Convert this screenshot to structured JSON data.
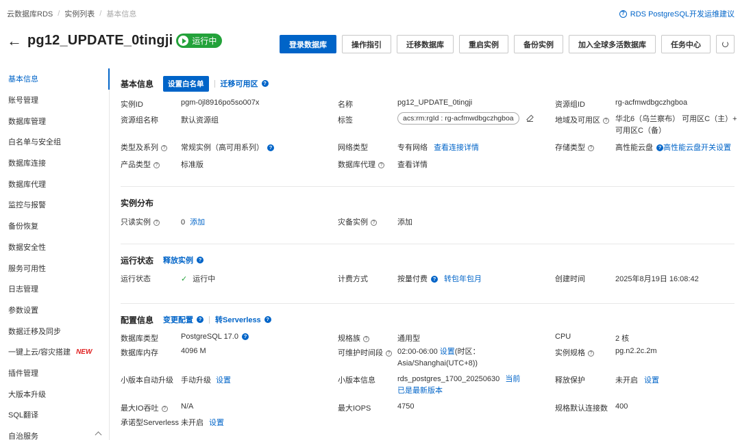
{
  "breadcrumb": [
    "云数据库RDS",
    "实例列表",
    "基本信息"
  ],
  "help_link": "RDS PostgreSQL开发运维建议",
  "title": "pg12_UPDATE_0tingji",
  "status": "运行中",
  "actions": [
    "登录数据库",
    "操作指引",
    "迁移数据库",
    "重启实例",
    "备份实例",
    "加入全球多活数据库",
    "任务中心"
  ],
  "sidebar": [
    {
      "label": "基本信息"
    },
    {
      "label": "账号管理"
    },
    {
      "label": "数据库管理"
    },
    {
      "label": "白名单与安全组"
    },
    {
      "label": "数据库连接"
    },
    {
      "label": "数据库代理"
    },
    {
      "label": "监控与报警"
    },
    {
      "label": "备份恢复"
    },
    {
      "label": "数据安全性"
    },
    {
      "label": "服务可用性"
    },
    {
      "label": "日志管理"
    },
    {
      "label": "参数设置"
    },
    {
      "label": "数据迁移及同步"
    },
    {
      "label": "一键上云/容灾搭建",
      "badge": "NEW"
    },
    {
      "label": "插件管理"
    },
    {
      "label": "大版本升级"
    },
    {
      "label": "SQL翻译"
    },
    {
      "label": "自治服务"
    }
  ],
  "basic": {
    "title": "基本信息",
    "whitelist_btn": "设置白名单",
    "migrate_link": "迁移可用区",
    "instance_id_label": "实例ID",
    "instance_id": "pgm-0jl8916po5so007x",
    "name_label": "名称",
    "name": "pg12_UPDATE_0tingji",
    "rg_id_label": "资源组ID",
    "rg_id": "rg-acfmwdbgczhgboa",
    "rg_name_label": "资源组名称",
    "rg_name": "默认资源组",
    "tags_label": "标签",
    "tags": "acs:rm:rgId : rg-acfmwdbgczhgboa",
    "region_label": "地域及可用区",
    "region": "华北6（乌兰察布） 可用区C（主）+ 可用区C（备）",
    "series_label": "类型及系列",
    "series": "常规实例（高可用系列）",
    "network_label": "网络类型",
    "network": "专有网络",
    "network_link": "查看连接详情",
    "storage_label": "存储类型",
    "storage": "高性能云盘",
    "storage_link": "高性能云盘开关设置",
    "product_label": "产品类型",
    "product": "标准版",
    "proxy_label": "数据库代理",
    "proxy_link": "查看详情"
  },
  "distribution": {
    "title": "实例分布",
    "readonly_label": "只读实例",
    "readonly_count": "0",
    "readonly_add": "添加",
    "dr_label": "灾备实例",
    "dr_add": "添加"
  },
  "running": {
    "title": "运行状态",
    "release_link": "释放实例",
    "status_label": "运行状态",
    "status": "运行中",
    "billing_label": "计费方式",
    "billing": "按量付费",
    "billing_link": "转包年包月",
    "created_label": "创建时间",
    "created": "2025年8月19日 16:08:42"
  },
  "config": {
    "title": "配置信息",
    "change_link": "变更配置",
    "serverless_link": "转Serverless",
    "db_type_label": "数据库类型",
    "db_type": "PostgreSQL  17.0",
    "spec_family_label": "规格族",
    "spec_family": "通用型",
    "cpu_label": "CPU",
    "cpu": "2 核",
    "memory_label": "数据库内存",
    "memory": "4096 M",
    "maint_label": "可维护时间段",
    "maint": "02:00-06:00",
    "maint_link": "设置",
    "maint_tz": "(时区：Asia/Shanghai(UTC+8))",
    "instance_spec_label": "实例规格",
    "instance_spec": "pg.n2.2c.2m",
    "auto_upgrade_label": "小版本自动升级",
    "auto_upgrade": "手动升级",
    "auto_upgrade_link": "设置",
    "minor_label": "小版本信息",
    "minor": "rds_postgres_1700_20250630",
    "minor_note": "当前已是最新版本",
    "release_protect_label": "释放保护",
    "release_protect": "未开启",
    "release_protect_link": "设置",
    "max_io_label": "最大IO吞吐",
    "max_io": "N/A",
    "max_iops_label": "最大IOPS",
    "max_iops": "4750",
    "max_conn_label": "规格默认连接数",
    "max_conn": "400",
    "serverless_label": "承诺型Serverless",
    "serverless": "未开启",
    "serverless_set": "设置"
  }
}
